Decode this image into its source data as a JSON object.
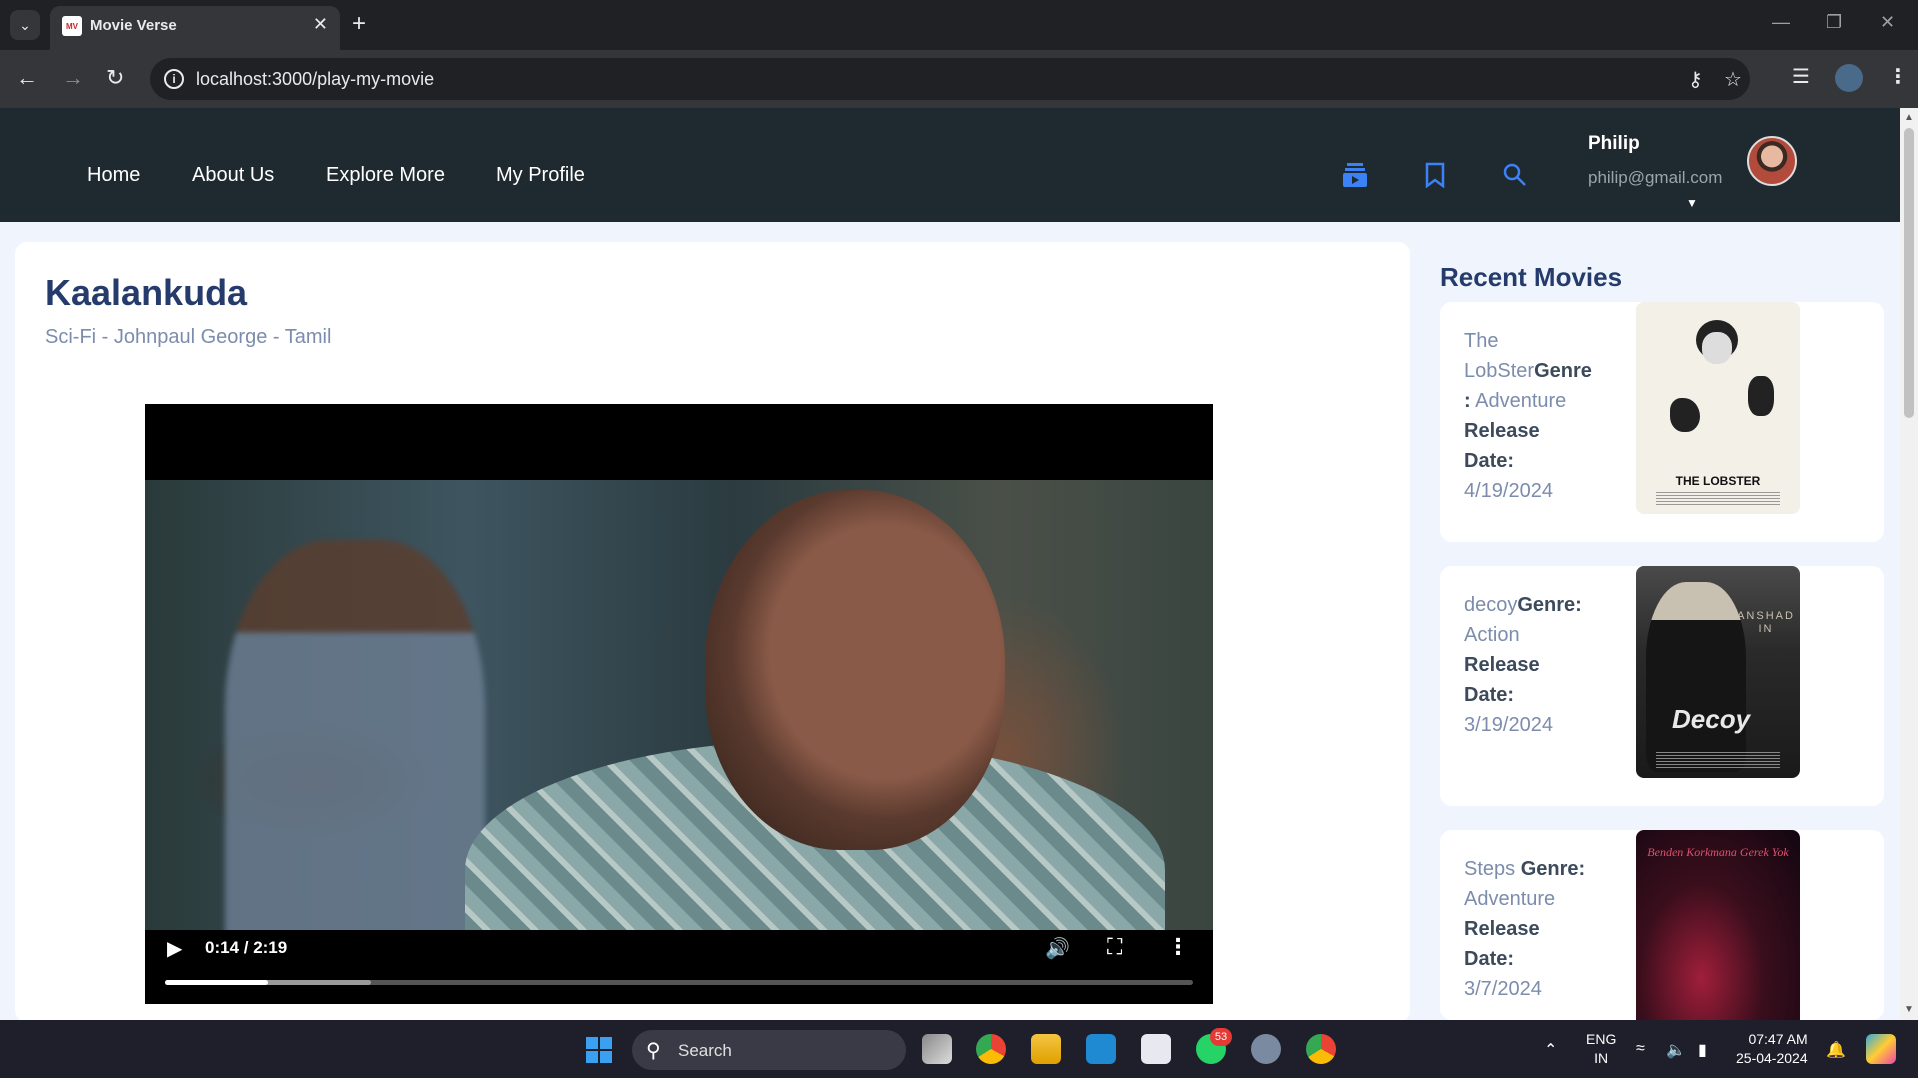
{
  "browser": {
    "tab_title": "Movie Verse",
    "favicon_text": "MV",
    "url": "localhost:3000/play-my-movie"
  },
  "site": {
    "nav": [
      "Home",
      "About Us",
      "Explore More",
      "My Profile"
    ],
    "user": {
      "name": "Philip",
      "email": "philip@gmail.com"
    },
    "icons": [
      "playlist-icon",
      "bookmark-icon",
      "search-icon"
    ],
    "accent_color": "#3b82f6"
  },
  "movie": {
    "title": "Kaalankuda",
    "subtitle": "Sci-Fi - Johnpaul George - Tamil",
    "player": {
      "time_label": "0:14 / 2:19",
      "played_fraction": 0.1,
      "buffered_fraction": 0.2
    }
  },
  "sidebar": {
    "title": "Recent Movies",
    "genre_label": "Genre:",
    "release_label": "Release Date:",
    "movies": [
      {
        "name": "The LobSter",
        "genre": "Adventure",
        "release_date": "4/19/2024",
        "poster_text": "THE LOBSTER"
      },
      {
        "name": "decoy",
        "genre": "Action",
        "release_date": "3/19/2024",
        "poster_name": "ANSHAD IN",
        "poster_logo": "Decoy"
      },
      {
        "name": "Steps ",
        "genre": "Adventure",
        "release_date": "3/7/2024",
        "poster_text": "Benden Korkmana Gerek Yok"
      }
    ]
  },
  "taskbar": {
    "search_label": "Search",
    "whatsapp_badge": "53",
    "lang_top": "ENG",
    "lang_bottom": "IN",
    "time": "07:47 AM",
    "date": "25-04-2024"
  }
}
